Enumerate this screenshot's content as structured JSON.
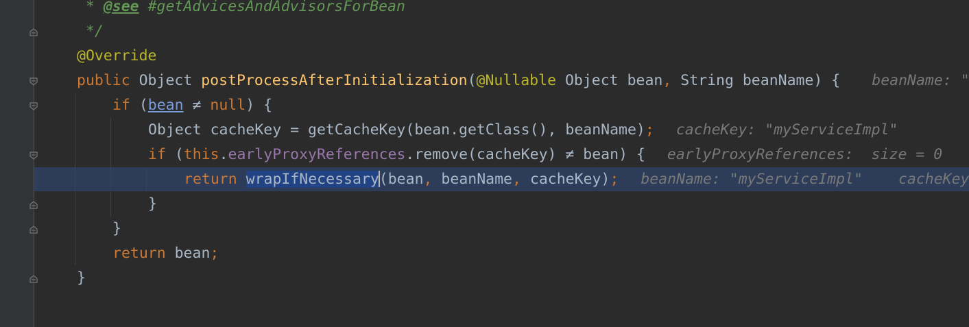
{
  "editor": {
    "language": "java",
    "colors": {
      "background": "#2b2b2b",
      "gutter": "#313335",
      "keyword": "#cc7832",
      "method": "#ffc66d",
      "annotation": "#bbb529",
      "comment": "#629755",
      "field": "#9876aa",
      "hint": "#787878",
      "current_line": "#2d3c58",
      "selection": "#214283"
    },
    "lines": {
      "l1": {
        "star": " * ",
        "tag": "@see",
        "text": " #getAdvicesAndAdvisorsForBean"
      },
      "l2": {
        "text": " */"
      },
      "l3": {
        "annotation": "@Override"
      },
      "l4": {
        "kw_public": "public",
        "type_object": " Object ",
        "method": "postProcessAfterInitialization",
        "paren_open": "(",
        "annotation": "@Nullable",
        "params1": " Object bean",
        "comma": ",",
        "params2": " String beanName) {",
        "hint": "beanName: \"m"
      },
      "l5": {
        "kw_if": "if",
        "open": " (",
        "var": "bean",
        "op": " ≠ ",
        "kw_null": "null",
        "close": ") {"
      },
      "l6": {
        "code": "Object cacheKey = getCacheKey(bean.getClass(), beanName)",
        "semi": ";",
        "hint": "cacheKey: \"myServiceImpl\""
      },
      "l7": {
        "kw_if": "if",
        "open": " (",
        "kw_this": "this",
        "dot": ".",
        "field": "earlyProxyReferences",
        "rest": ".remove(cacheKey) ≠ bean) {",
        "hint": "earlyProxyReferences:  size = 0"
      },
      "l8": {
        "kw_return": "return",
        "space": " ",
        "selected": "wrapIfNecessary",
        "args_open": "(bean",
        "c1": ",",
        "args_mid": " beanName",
        "c2": ",",
        "args_end": " cacheKey)",
        "semi": ";",
        "hint1": "beanName: \"myServiceImpl\"",
        "hint2": "cacheKey"
      },
      "l9": {
        "text": "}"
      },
      "l10": {
        "text": "}"
      },
      "l11": {
        "kw_return": "return",
        "rest": " bean",
        "semi": ";"
      },
      "l12": {
        "text": "}"
      }
    }
  }
}
